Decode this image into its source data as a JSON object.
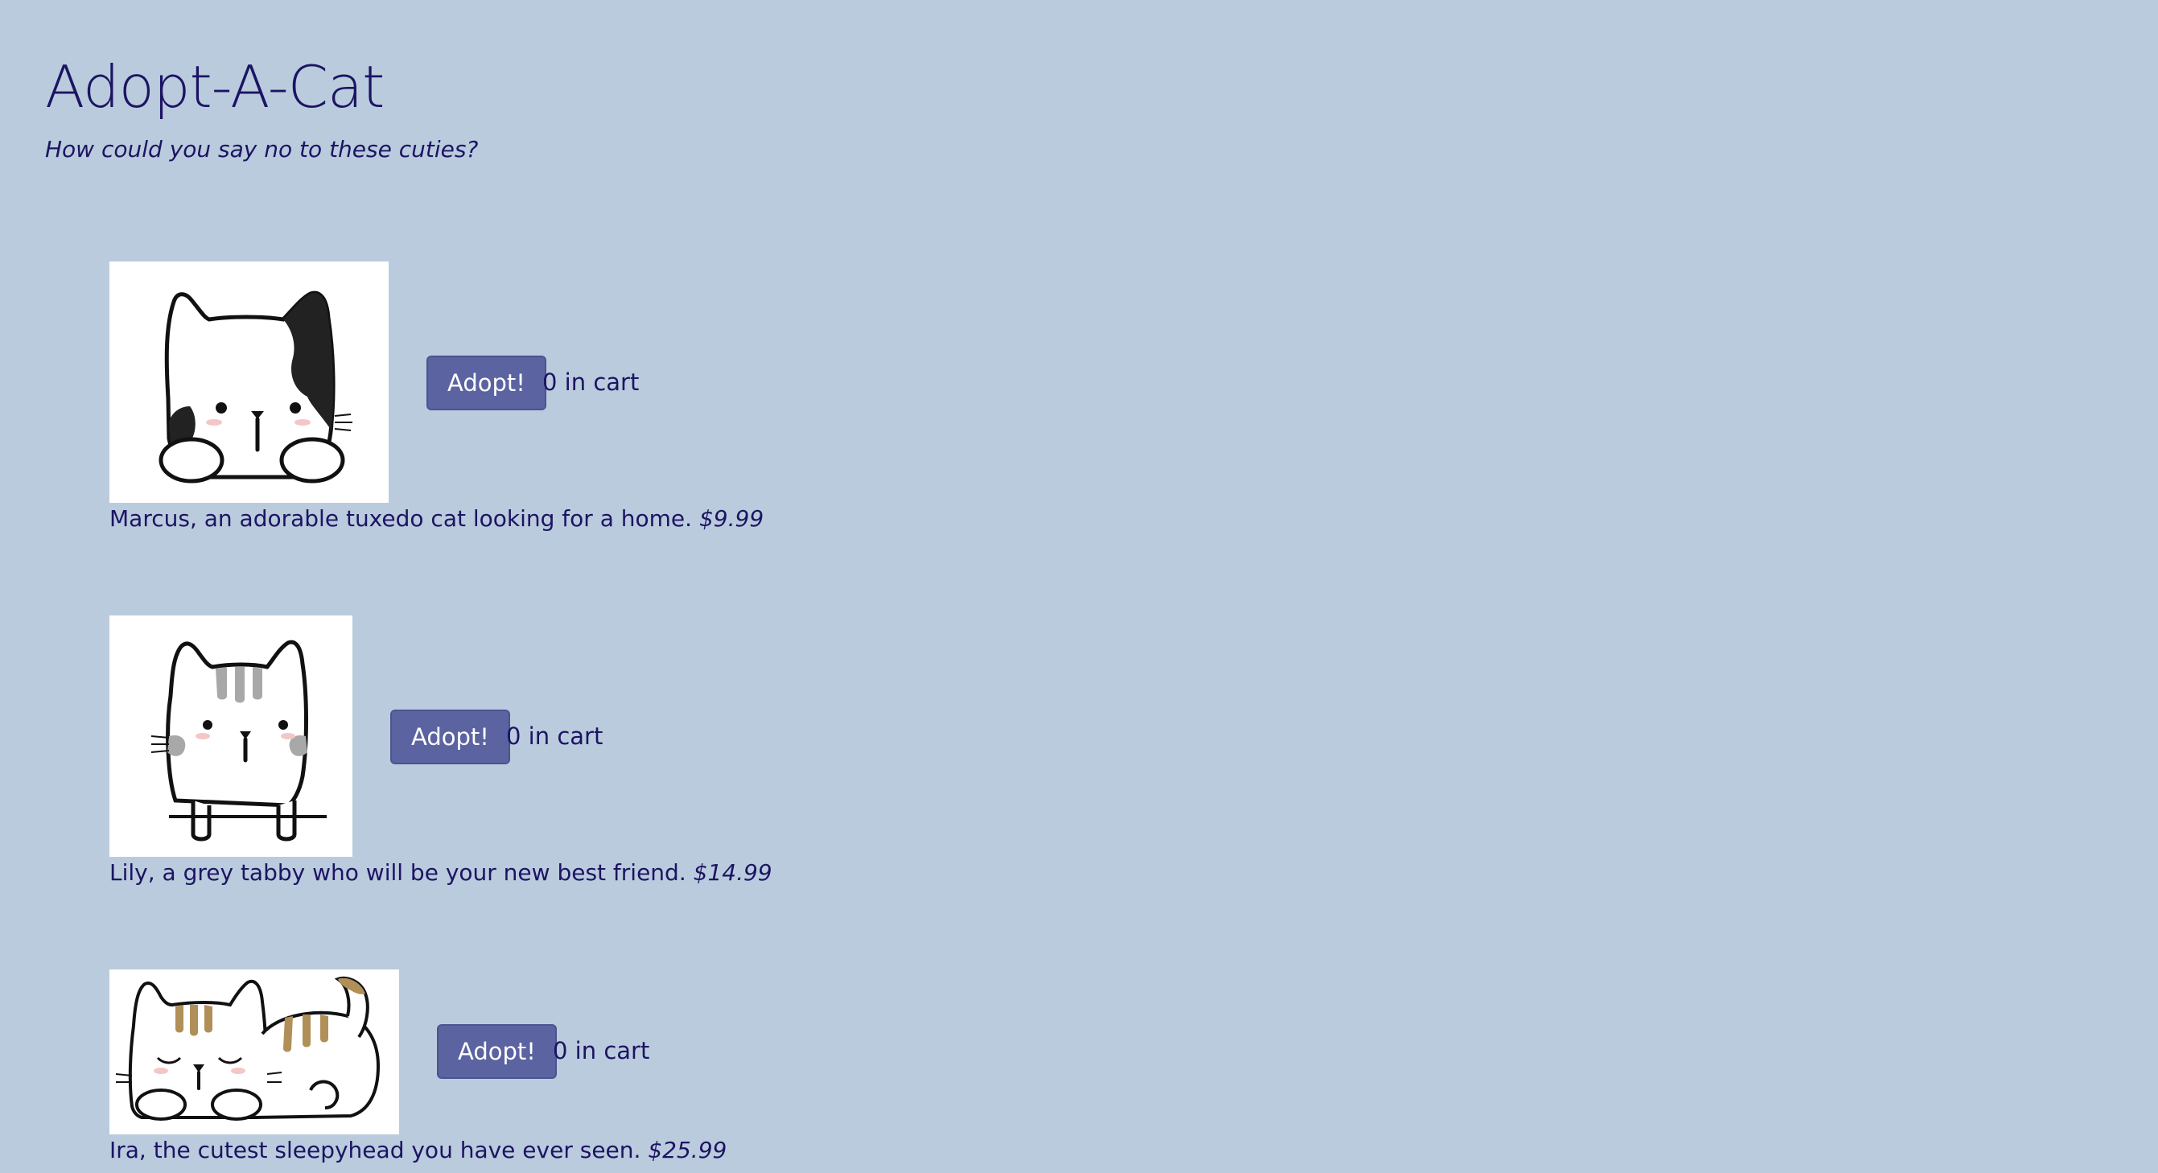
{
  "page": {
    "title": "Adopt-A-Cat",
    "subtitle": "How could you say no to these cuties?",
    "background_color": "#bacbdd",
    "text_color": "#1c1463",
    "button_color": "#5b63a1"
  },
  "cats": [
    {
      "image_icon": "tuxedo-cat-illustration",
      "button_label": "Adopt!",
      "cart_count": "0",
      "cart_suffix": " in cart",
      "description": "Marcus, an adorable tuxedo cat looking for a home.",
      "price": "$9.99"
    },
    {
      "image_icon": "grey-tabby-cat-illustration",
      "button_label": "Adopt!",
      "cart_count": "0",
      "cart_suffix": " in cart",
      "description": "Lily, a grey tabby who will be your new best friend.",
      "price": "$14.99"
    },
    {
      "image_icon": "sleeping-cat-illustration",
      "button_label": "Adopt!",
      "cart_count": "0",
      "cart_suffix": " in cart",
      "description": "Ira, the cutest sleepyhead you have ever seen.",
      "price": "$25.99"
    }
  ]
}
